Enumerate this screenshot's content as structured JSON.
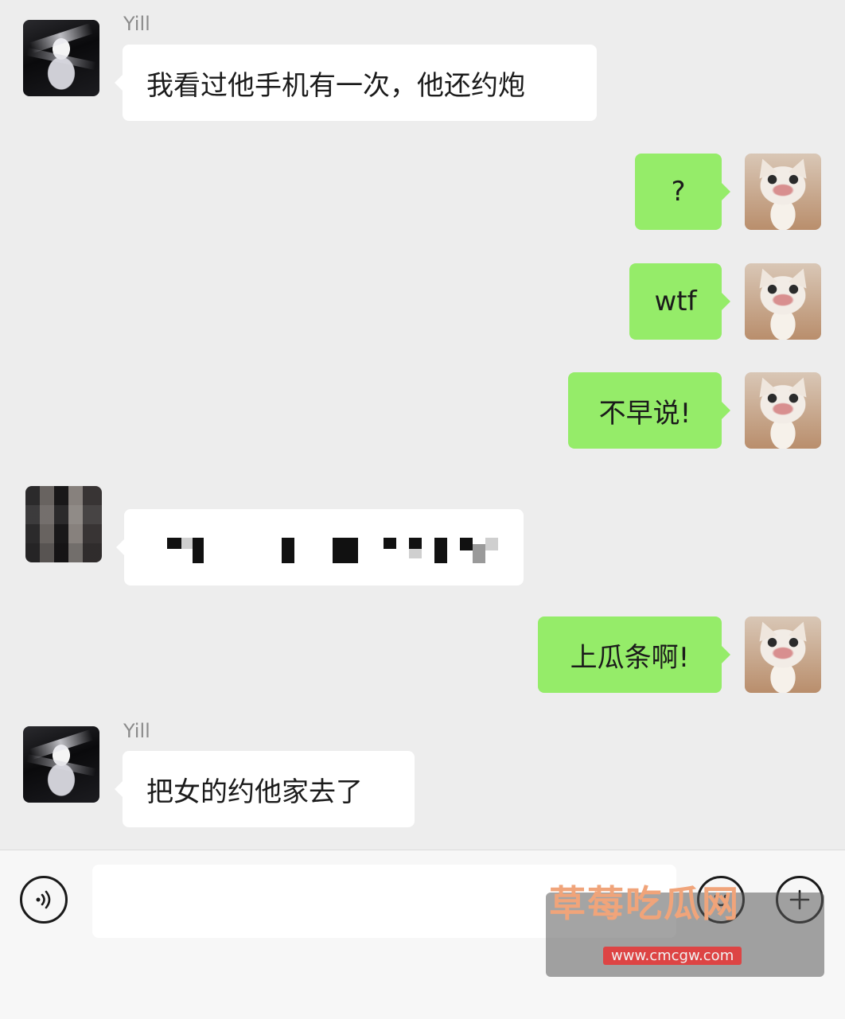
{
  "messages": [
    {
      "sender": "Yill",
      "text": "我看过他手机有一次，他还约炮"
    },
    {
      "text": "?"
    },
    {
      "text": "wtf"
    },
    {
      "text": "不早说!"
    },
    {
      "text": "上瓜条啊!"
    },
    {
      "sender": "Yill",
      "text": "把女的约他家去了"
    }
  ],
  "input": {
    "placeholder": ""
  },
  "watermark": {
    "title": "草莓吃瓜网",
    "url": "www.cmcgw.com"
  },
  "icons": {
    "voice": "voice-icon",
    "emoji": "emoji-icon",
    "plus": "plus-icon"
  }
}
